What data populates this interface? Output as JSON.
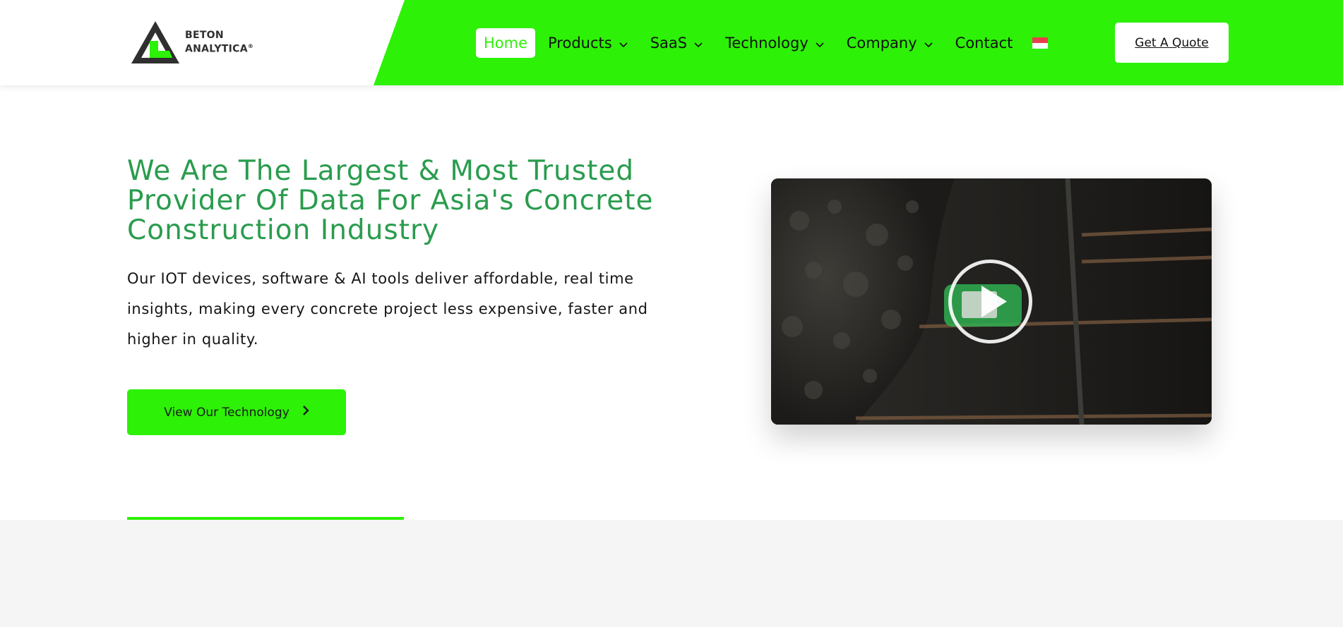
{
  "brand": {
    "name_line1": "BETON",
    "name_line2": "ANALYTICA",
    "registered": "®"
  },
  "nav": {
    "items": [
      {
        "label": "Home",
        "active": true,
        "dropdown": false
      },
      {
        "label": "Products",
        "active": false,
        "dropdown": true
      },
      {
        "label": "SaaS",
        "active": false,
        "dropdown": true
      },
      {
        "label": "Technology",
        "active": false,
        "dropdown": true
      },
      {
        "label": "Company",
        "active": false,
        "dropdown": true
      },
      {
        "label": "Contact",
        "active": false,
        "dropdown": false
      }
    ],
    "language_icon": "indonesia-flag-icon",
    "quote_label": "Get A Quote"
  },
  "hero": {
    "title_line1": "We Are The Largest & Most Trusted",
    "title_line2": "Provider Of Data For Asia's Concrete",
    "title_line3": "Construction Industry",
    "desc_line1": "Our IOT devices, software & AI tools deliver affordable, real time",
    "desc_line2": "insights, making every concrete project less expensive, faster and",
    "desc_line3": "higher in quality.",
    "cta_label": "View Our Technology",
    "video_play_icon": "play-icon"
  },
  "colors": {
    "accent_green": "#2df106",
    "title_green": "#2a9c4e",
    "lower_bg": "#f5f5f5"
  }
}
